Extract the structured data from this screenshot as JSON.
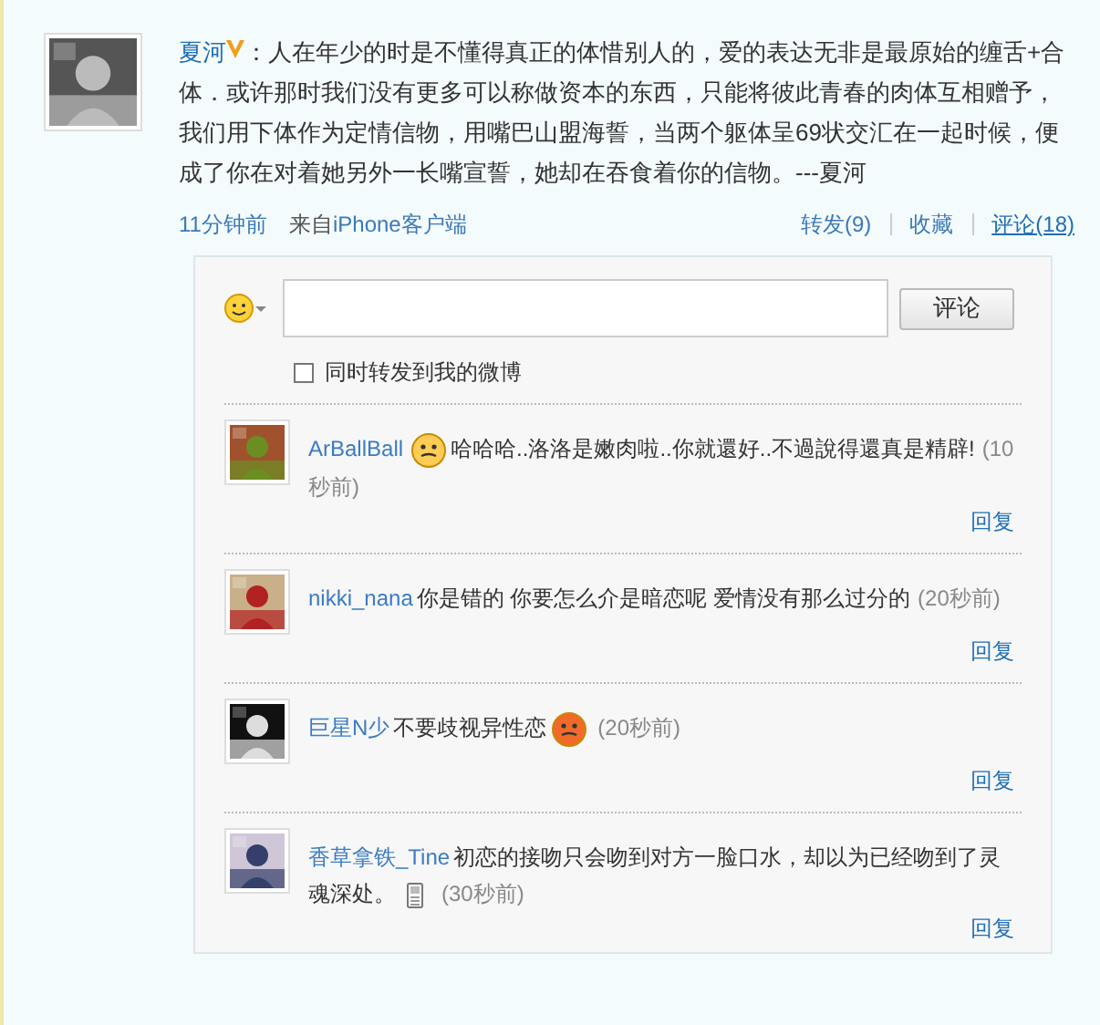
{
  "post": {
    "author": "夏河",
    "verified": true,
    "text": "：人在年少的时是不懂得真正的体惜别人的，爱的表达无非是最原始的缠舌+合体．或许那时我们没有更多可以称做资本的东西，只能将彼此青春的肉体互相赠予，我们用下体作为定情信物，用嘴巴山盟海誓，当两个躯体呈69状交汇在一起时候，便成了你在对着她另外一长嘴宣誓，她却在吞食着你的信物。---夏河",
    "time": "11分钟前",
    "source_prefix": "来自",
    "source": "iPhone客户端",
    "actions": [
      {
        "label": "转发(9)",
        "selected": false
      },
      {
        "label": "收藏",
        "selected": false
      },
      {
        "label": "评论(18)",
        "selected": true
      }
    ]
  },
  "composer": {
    "submit": "评论",
    "repost_label": "同时转发到我的微博",
    "repost_checked": false
  },
  "comments": [
    {
      "kind": "emoticon_before",
      "name": "ArBallBall",
      "text": "哈哈哈..洛洛是嫩肉啦..你就還好..不過說得還真是精辟!",
      "time": "(10秒前)",
      "reply": "回复"
    },
    {
      "kind": "plain",
      "name": "nikki_nana",
      "text": "你是错的  你要怎么介是暗恋呢  爱情没有那么过分的",
      "time": "(20秒前)",
      "reply": "回复"
    },
    {
      "kind": "emoticon_after",
      "name": "巨星N少",
      "text": "不要歧视异性恋",
      "time": "(20秒前)",
      "reply": "回复"
    },
    {
      "kind": "phone",
      "name": "香草拿铁_Tine",
      "text": "初恋的接吻只会吻到对方一脸口水，却以为已经吻到了灵魂深处。",
      "time": "(30秒前)",
      "reply": "回复"
    }
  ]
}
